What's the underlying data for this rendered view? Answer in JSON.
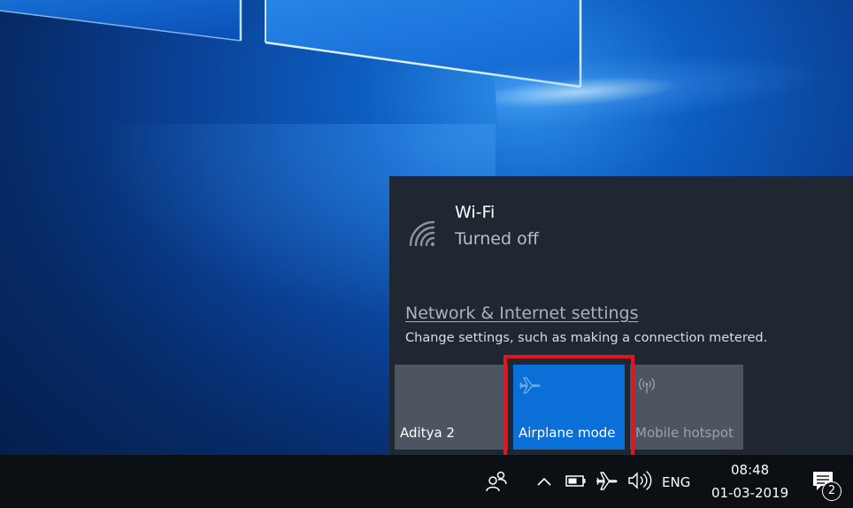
{
  "wifi": {
    "title": "Wi-Fi",
    "status": "Turned off",
    "icon": "wifi-icon"
  },
  "settings": {
    "link_label": "Network & Internet settings",
    "description": "Change settings, such as making a connection metered."
  },
  "tiles": [
    {
      "label": "Aditya 2",
      "icon": "none",
      "active": false
    },
    {
      "label": "Airplane mode",
      "icon": "airplane-icon",
      "active": true
    },
    {
      "label": "Mobile hotspot",
      "icon": "hotspot-icon",
      "active": false
    }
  ],
  "taskbar": {
    "language": "ENG",
    "time": "08:48",
    "date": "01-03-2019",
    "notification_count": "2",
    "icons": [
      "people-icon",
      "chevron-up-icon",
      "battery-icon",
      "airplane-icon",
      "volume-icon",
      "action-center-icon"
    ]
  },
  "colors": {
    "flyout_bg": "#1f2733",
    "tile_active": "#0a6fd6",
    "tile_inactive": "#4d5560",
    "highlight": "#e8141b",
    "taskbar_bg": "#0c0f14"
  }
}
